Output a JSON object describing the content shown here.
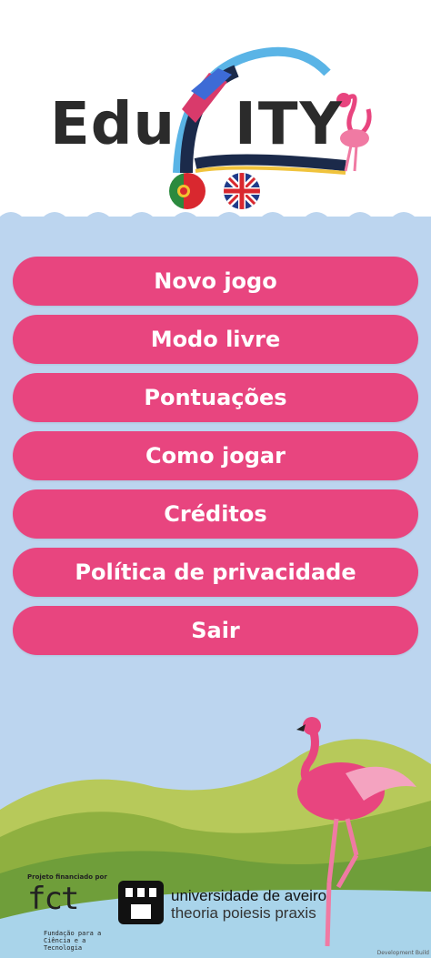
{
  "logo": {
    "part1": "Edu",
    "part2": "ITY"
  },
  "languages": [
    {
      "name": "portuguese-flag-icon"
    },
    {
      "name": "english-flag-icon"
    }
  ],
  "menu": [
    {
      "label": "Novo jogo"
    },
    {
      "label": "Modo livre"
    },
    {
      "label": "Pontuações"
    },
    {
      "label": "Como jogar"
    },
    {
      "label": "Créditos"
    },
    {
      "label": "Política de privacidade"
    },
    {
      "label": "Sair"
    }
  ],
  "footer": {
    "funded_by": "Projeto financiado por",
    "fct": "fct",
    "fct_subtitle": "Fundação para a Ciência e a Tecnologia",
    "university_name": "universidade de aveiro",
    "university_motto": "theoria poiesis praxis",
    "build": "Development Build"
  },
  "colors": {
    "button": "#e8457f",
    "water": "#bcd5ef",
    "flamingo": "#e8457f"
  }
}
